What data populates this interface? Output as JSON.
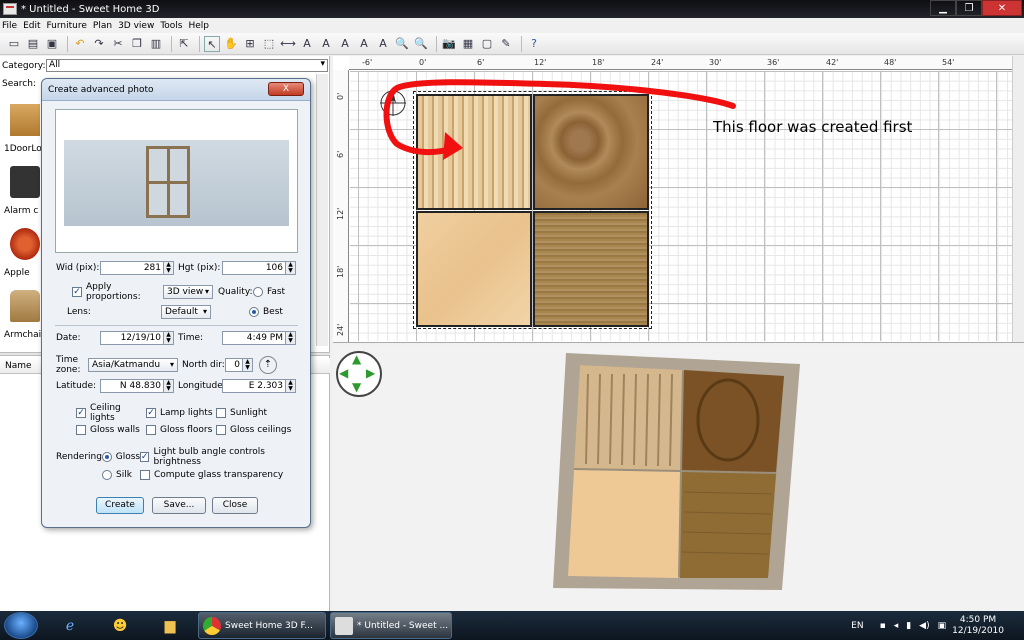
{
  "window": {
    "title": "* Untitled - Sweet Home 3D"
  },
  "menu": [
    "File",
    "Edit",
    "Furniture",
    "Plan",
    "3D view",
    "Tools",
    "Help"
  ],
  "toolbar": {
    "icons": [
      "new-icon",
      "open-icon",
      "save-icon",
      "undo-icon",
      "redo-icon",
      "cut-icon",
      "copy-icon",
      "paste-icon",
      "add-furniture-icon",
      "select-icon",
      "pan-icon",
      "create-walls-icon",
      "create-rooms-icon",
      "create-dimensions-icon",
      "add-text-icon",
      "zoom-in-text-icon",
      "zoom-out-text-icon",
      "zoom-in-icon",
      "zoom-out-icon",
      "create-photo-icon",
      "create-video-icon",
      "preferences-icon",
      "help-icon"
    ]
  },
  "catalog": {
    "category_label": "Category:",
    "category_value": "All",
    "search_label": "Search:",
    "items": [
      {
        "label": "1DoorLo"
      },
      {
        "label": "Alarm c"
      },
      {
        "label": "Apple"
      },
      {
        "label": "Armchai"
      }
    ],
    "name_header": "Name"
  },
  "plan": {
    "ruler_top": [
      "-6'",
      "0'",
      "6'",
      "12'",
      "18'",
      "24'",
      "30'",
      "36'",
      "42'",
      "48'",
      "54'"
    ],
    "ruler_left": [
      "0'",
      "6'",
      "12'",
      "18'",
      "24'"
    ],
    "annotation": "This floor was created first"
  },
  "dialog": {
    "title": "Create advanced photo",
    "close_label": "X",
    "width_label": "Wid (pix):",
    "width_value": "281",
    "height_label": "Hgt (pix):",
    "height_value": "106",
    "apply_proportions_label": "Apply proportions:",
    "proportions_value": "3D view",
    "quality_label": "Quality:",
    "fast_label": "Fast",
    "best_label": "Best",
    "lens_label": "Lens:",
    "lens_value": "Default",
    "date_label": "Date:",
    "date_value": "12/19/10",
    "time_label": "Time:",
    "time_value": "4:49 PM",
    "timezone_label": "Time zone:",
    "timezone_value": "Asia/Katmandu",
    "north_label": "North dir:",
    "north_value": "0",
    "latitude_label": "Latitude:",
    "latitude_value": "N 48.830",
    "longitude_label": "Longitude:",
    "longitude_value": "E 2.303",
    "ceiling_lights": "Ceiling lights",
    "lamp_lights": "Lamp lights",
    "sunlight": "Sunlight",
    "gloss_walls": "Gloss walls",
    "gloss_floors": "Gloss floors",
    "gloss_ceilings": "Gloss ceilings",
    "rendering_label": "Rendering:",
    "gloss_label": "Gloss",
    "light_bulb_label": "Light bulb angle controls brightness",
    "silk_label": "Silk",
    "glass_label": "Compute glass transparency",
    "create_button": "Create",
    "save_button": "Save...",
    "close_button": "Close"
  },
  "taskbar": {
    "task1": "Sweet Home 3D F...",
    "task2": "* Untitled - Sweet ...",
    "lang": "EN",
    "time": "4:50 PM",
    "date": "12/19/2010"
  }
}
